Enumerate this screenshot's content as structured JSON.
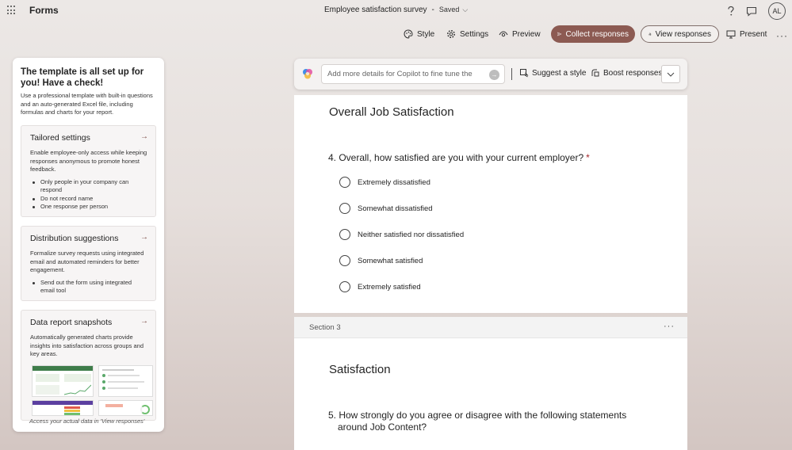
{
  "app": {
    "name": "Forms"
  },
  "document": {
    "title": "Employee satisfaction survey",
    "separator": "-",
    "status": "Saved"
  },
  "user": {
    "initials": "AL"
  },
  "toolbar": {
    "style": "Style",
    "settings": "Settings",
    "preview": "Preview",
    "collect": "Collect responses",
    "view_responses": "View responses",
    "present": "Present"
  },
  "left_panel": {
    "title": "The template is all set up for you! Have a check!",
    "description": "Use a professional template with built-in questions and an auto-generated Excel file, including formulas and charts for your report.",
    "cards": [
      {
        "title": "Tailored settings",
        "description": "Enable employee-only access while keeping responses anonymous to promote honest feedback.",
        "bullets": [
          "Only people in your company can respond",
          "Do not record name",
          "One response per person"
        ]
      },
      {
        "title": "Distribution suggestions",
        "description": "Formalize survey requests using integrated email and automated reminders for better engagement.",
        "bullets": [
          "Send out the form using integrated email tool"
        ]
      },
      {
        "title": "Data report snapshots",
        "description": "Automatically generated charts provide insights into satisfaction across groups and key areas."
      }
    ],
    "footer": "Access your actual data in 'View responses'"
  },
  "copilot": {
    "placeholder": "Add more details for Copilot to fine tune the",
    "suggest_style": "Suggest a style",
    "boost": "Boost responses"
  },
  "form": {
    "section1_title": "Overall Job Satisfaction",
    "question4": {
      "text": "4. Overall, how satisfied are you with your current employer?",
      "required_mark": "*",
      "options": [
        "Extremely dissatisfied",
        "Somewhat dissatisfied",
        "Neither satisfied nor dissatisfied",
        "Somewhat satisfied",
        "Extremely satisfied"
      ]
    },
    "section3_label": "Section 3",
    "section3_title": "Satisfaction",
    "question5": {
      "text_line1": "5. How strongly do you agree or disagree with the following statements",
      "text_line2": "around Job Content?"
    }
  },
  "colors": {
    "accent": "#8c5a52",
    "required": "#a4262c"
  },
  "icons": [
    "app-launcher-icon",
    "help-icon",
    "feedback-icon",
    "palette-icon",
    "gear-icon",
    "eye-icon",
    "send-icon",
    "chart-icon",
    "present-icon",
    "more-icon",
    "copilot-icon",
    "arrow-right-icon",
    "style-brush-icon",
    "boost-icon",
    "chevron-down-icon"
  ]
}
